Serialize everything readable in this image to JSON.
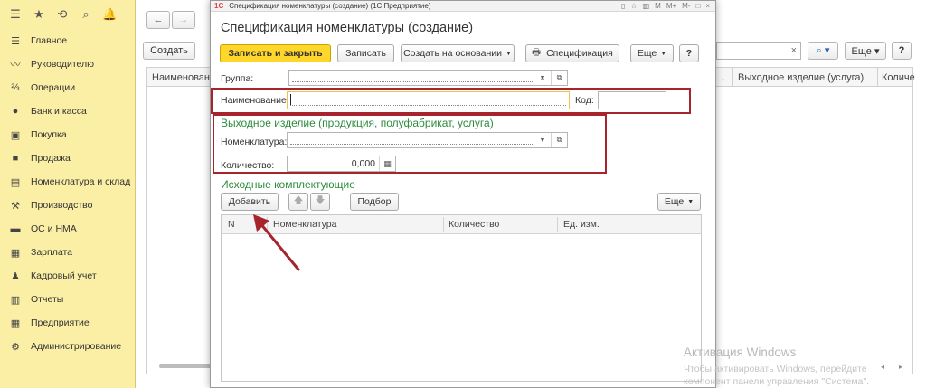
{
  "sidebar": {
    "top_icons": [
      "☰",
      "★",
      "⟲",
      "⌕",
      "🔔"
    ],
    "items": [
      {
        "icon": "☰",
        "label": "Главное"
      },
      {
        "icon": "〰",
        "label": "Руководителю"
      },
      {
        "icon": "⅔",
        "label": "Операции"
      },
      {
        "icon": "●",
        "label": "Банк и касса"
      },
      {
        "icon": "▣",
        "label": "Покупка"
      },
      {
        "icon": "■",
        "label": "Продажа"
      },
      {
        "icon": "▤",
        "label": "Номенклатура и склад"
      },
      {
        "icon": "⚒",
        "label": "Производство"
      },
      {
        "icon": "▬",
        "label": "ОС и НМА"
      },
      {
        "icon": "▦",
        "label": "Зарплата"
      },
      {
        "icon": "♟",
        "label": "Кадровый учет"
      },
      {
        "icon": "▥",
        "label": "Отчеты"
      },
      {
        "icon": "▦",
        "label": "Предприятие"
      },
      {
        "icon": "⚙",
        "label": "Администрирование"
      }
    ]
  },
  "background": {
    "create_label": "Создать",
    "more_label": "Еще ▾",
    "help_label": "?",
    "search_clear": "×",
    "columns": [
      "Наименование",
      "Выходное изделие (услуга)",
      "Количе"
    ]
  },
  "window": {
    "logo": "1С",
    "caption": "Спецификация номенклатуры (создание) (1С:Предприятие)",
    "caption_buttons": [
      "▯",
      "☆",
      "▥",
      "M",
      "M+",
      "M-",
      "□",
      "×"
    ]
  },
  "form": {
    "title": "Спецификация номенклатуры (создание)",
    "toolbar": {
      "save_close": "Записать и закрыть",
      "save": "Записать",
      "create_based": "Создать на основании",
      "spec": "Спецификация",
      "more": "Еще",
      "help": "?"
    },
    "group_label": "Группа:",
    "name_label": "Наименование:",
    "name_value": "",
    "code_label": "Код:",
    "code_value": "",
    "output_section": "Выходное изделие (продукция, полуфабрикат, услуга)",
    "nomenclature_label": "Номенклатура:",
    "quantity_label": "Количество:",
    "quantity_value": "0,000",
    "source_section": "Исходные комплектующие",
    "add_button": "Добавить",
    "select_button": "Подбор",
    "grid_more": "Еще",
    "grid_columns": [
      "N",
      "Номенклатура",
      "Количество",
      "Ед. изм."
    ]
  },
  "watermark": {
    "line1": "Активация Windows",
    "line2": "Чтобы активировать Windows, перейдите",
    "line3": "компонент панели управления \"Система\"."
  },
  "colors": {
    "sidebar_bg": "#fbefa6",
    "primary_button": "#ffd62a",
    "section_green": "#2c8c3c",
    "highlight_red": "#a8242d"
  }
}
